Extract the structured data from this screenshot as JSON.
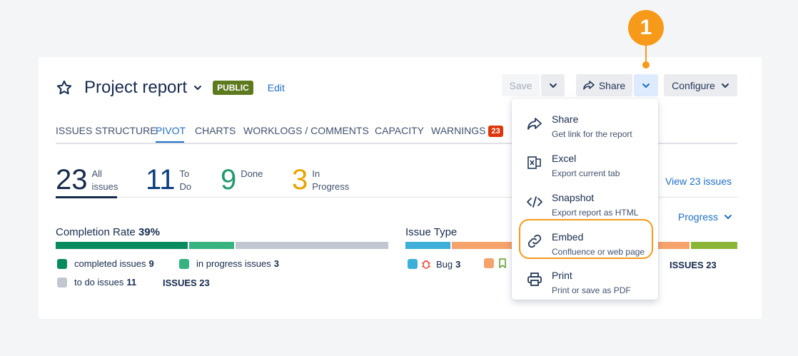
{
  "step": {
    "number": "1"
  },
  "header": {
    "title": "Project report",
    "badge": "PUBLIC",
    "edit": "Edit"
  },
  "toolbar": {
    "save": "Save",
    "share": "Share",
    "configure": "Configure"
  },
  "tabs": [
    {
      "label": "ISSUES STRUCTURE"
    },
    {
      "label": "PIVOT"
    },
    {
      "label": "CHARTS"
    },
    {
      "label": "WORKLOGS / COMMENTS"
    },
    {
      "label": "CAPACITY"
    },
    {
      "label": "WARNINGS",
      "count": "23"
    }
  ],
  "stats": [
    {
      "value": "23",
      "label1": "All",
      "label2": "issues",
      "color": "#172b4d"
    },
    {
      "value": "11",
      "label1": "To",
      "label2": "Do",
      "color": "#0c3f7c"
    },
    {
      "value": "9",
      "label1": "Done",
      "label2": "",
      "color": "#1f9a6b"
    },
    {
      "value": "3",
      "label1": "In",
      "label2": "Progress",
      "color": "#e8a400"
    }
  ],
  "view_issues": "View 23 issues",
  "progress_dropdown": "Progress",
  "completion": {
    "title": "Completion Rate",
    "percent": "39%",
    "bar": [
      {
        "name": "completed",
        "fraction": 0.39,
        "color": "#0a8a5f"
      },
      {
        "name": "in progress",
        "fraction": 0.14,
        "color": "#36b37e"
      },
      {
        "name": "to do",
        "fraction": 0.47,
        "color": "#c1c7d0"
      }
    ],
    "legend": [
      {
        "label": "completed issues",
        "count": "9",
        "color": "#0a8a5f"
      },
      {
        "label": "in progress issues",
        "count": "3",
        "color": "#36b37e"
      },
      {
        "label": "to do issues",
        "count": "11",
        "color": "#c1c7d0"
      }
    ],
    "total": "ISSUES 23"
  },
  "issue_type": {
    "title": "Issue Type",
    "legend": [
      {
        "label": "Bug",
        "count": "3",
        "color": "#3eafd8"
      },
      {
        "label": "",
        "count": "",
        "color": "#f6a36b"
      }
    ],
    "total": "ISSUES 23"
  },
  "share_menu": [
    {
      "title": "Share",
      "subtitle": "Get link for the report",
      "icon": "share-arrow-icon"
    },
    {
      "title": "Excel",
      "subtitle": "Export current tab",
      "icon": "excel-icon"
    },
    {
      "title": "Snapshot",
      "subtitle": "Export report as HTML",
      "icon": "code-icon"
    },
    {
      "title": "Embed",
      "subtitle": "Confluence or web page",
      "icon": "link-icon"
    },
    {
      "title": "Print",
      "subtitle": "Print or save as PDF",
      "icon": "printer-icon"
    }
  ],
  "colors": {
    "accent": "#1f6fc5",
    "highlight": "#f79a1a",
    "public_badge": "#5e7a1f",
    "warning_badge": "#de350b"
  }
}
